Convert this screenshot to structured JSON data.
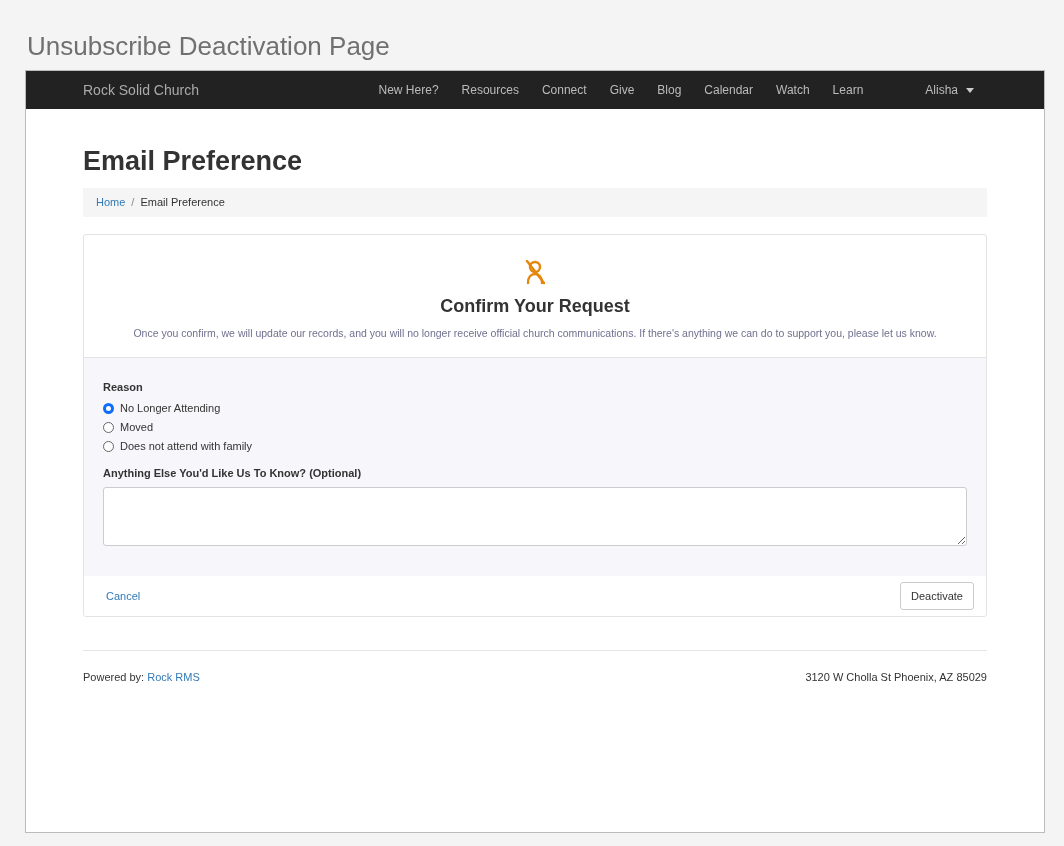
{
  "page_title": "Unsubscribe Deactivation Page",
  "navbar": {
    "brand": "Rock Solid Church",
    "links": [
      "New Here?",
      "Resources",
      "Connect",
      "Give",
      "Blog",
      "Calendar",
      "Watch",
      "Learn"
    ],
    "user": "Alisha"
  },
  "heading": "Email Preference",
  "breadcrumb": [
    "Home",
    "Email Preference"
  ],
  "breadcrumb_separator": "/",
  "card": {
    "title": "Confirm Your Request",
    "message": "Once you confirm, we will update our records, and you will no longer receive official church communications. If there's anything we can do to support you, please let us know.",
    "reason_label": "Reason",
    "reasons": [
      {
        "label": "No Longer Attending",
        "selected": true
      },
      {
        "label": "Moved",
        "selected": false
      },
      {
        "label": "Does not attend with family",
        "selected": false
      }
    ],
    "comments_label": "Anything Else You'd Like Us To Know? (Optional)",
    "cancel": "Cancel",
    "deactivate": "Deactivate"
  },
  "footer": {
    "credit": "Powered by:",
    "credit_link": "Rock RMS",
    "address": "3120 W Cholla St Phoenix, AZ 85029"
  }
}
